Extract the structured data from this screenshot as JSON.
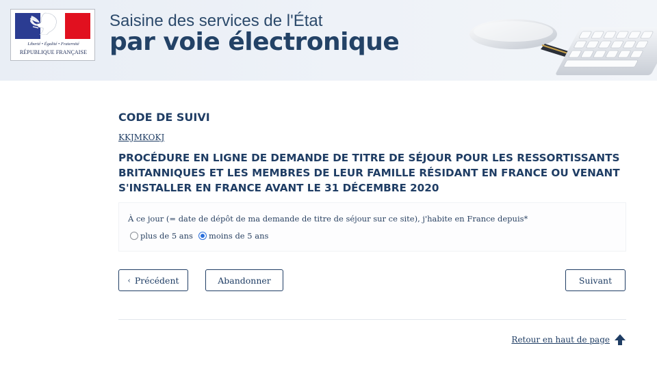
{
  "header": {
    "logo": {
      "motto": "Liberté • Égalité • Fraternité",
      "republique": "RÉPUBLIQUE FRANÇAISE",
      "icon": "marianne-logo"
    },
    "title_line1": "Saisine des services de l'État",
    "title_line2": "par voie électronique"
  },
  "tracking": {
    "heading": "CODE DE SUIVI",
    "code": "KKJMKOKJ"
  },
  "procedure": {
    "title": "PROCÉDURE EN LIGNE DE DEMANDE DE TITRE DE SÉJOUR POUR LES RESSORTISSANTS BRITANNIQUES ET LES MEMBRES DE LEUR FAMILLE RÉSIDANT EN FRANCE OU VENANT S'INSTALLER EN FRANCE AVANT LE 31 DÉCEMBRE 2020"
  },
  "question": {
    "label": "À ce jour (= date de dépôt de ma demande de titre de séjour sur ce site), j'habite en France depuis*",
    "options": [
      {
        "label": "plus de 5 ans",
        "selected": false
      },
      {
        "label": "moins de 5 ans",
        "selected": true
      }
    ]
  },
  "buttons": {
    "previous": "Précédent",
    "abandon": "Abandonner",
    "next": "Suivant"
  },
  "footer": {
    "back_to_top": "Retour en haut de page",
    "icon": "arrow-up-icon"
  },
  "colors": {
    "primary": "#1f3d64",
    "flag_blue": "#2b3c92",
    "flag_red": "#e1101f",
    "radio_selected": "#2a6fdb"
  }
}
